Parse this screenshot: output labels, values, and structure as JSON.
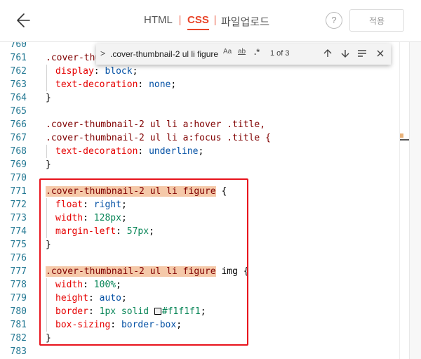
{
  "toolbar": {
    "tabs": [
      {
        "label": "HTML"
      },
      {
        "label": "CSS"
      },
      {
        "label": "파일업로드"
      }
    ],
    "help_label": "?",
    "apply_label": "적용",
    "accent_color": "#e8452a"
  },
  "find": {
    "query": ".cover-thumbnail-2 ul li figure",
    "case_label": "Aa",
    "word_label": "ab",
    "regex_label": ".*",
    "count": "1 of 3"
  },
  "lines": [
    {
      "num": "760",
      "code": ""
    },
    {
      "num": "761",
      "code": ".cover-thu"
    },
    {
      "num": "762",
      "prop": "display",
      "val": "block"
    },
    {
      "num": "763",
      "prop": "text-decoration",
      "val": "none"
    },
    {
      "num": "764",
      "code": "}"
    },
    {
      "num": "765",
      "code": ""
    },
    {
      "num": "766",
      "code": ".cover-thumbnail-2 ul li a:hover .title,"
    },
    {
      "num": "767",
      "code": ".cover-thumbnail-2 ul li a:focus .title {"
    },
    {
      "num": "768",
      "prop": "text-decoration",
      "val": "underline"
    },
    {
      "num": "769",
      "code": "}"
    },
    {
      "num": "770",
      "code": ""
    },
    {
      "num": "771",
      "hl": ".cover-thumbnail-2 ul li figure",
      "rest": " {"
    },
    {
      "num": "772",
      "prop": "float",
      "val": "right"
    },
    {
      "num": "773",
      "prop": "width",
      "val": "128px"
    },
    {
      "num": "774",
      "prop": "margin-left",
      "val": "57px"
    },
    {
      "num": "775",
      "code": "}"
    },
    {
      "num": "776",
      "code": ""
    },
    {
      "num": "777",
      "hl": ".cover-thumbnail-2 ul li figure",
      "rest": " img {"
    },
    {
      "num": "778",
      "prop": "width",
      "val": "100%"
    },
    {
      "num": "779",
      "prop": "height",
      "val": "auto"
    },
    {
      "num": "780",
      "prop": "border",
      "val": "1px solid",
      "color": "#f1f1f1"
    },
    {
      "num": "781",
      "prop": "box-sizing",
      "val": "border-box"
    },
    {
      "num": "782",
      "code": "}"
    },
    {
      "num": "783",
      "code": ""
    }
  ]
}
